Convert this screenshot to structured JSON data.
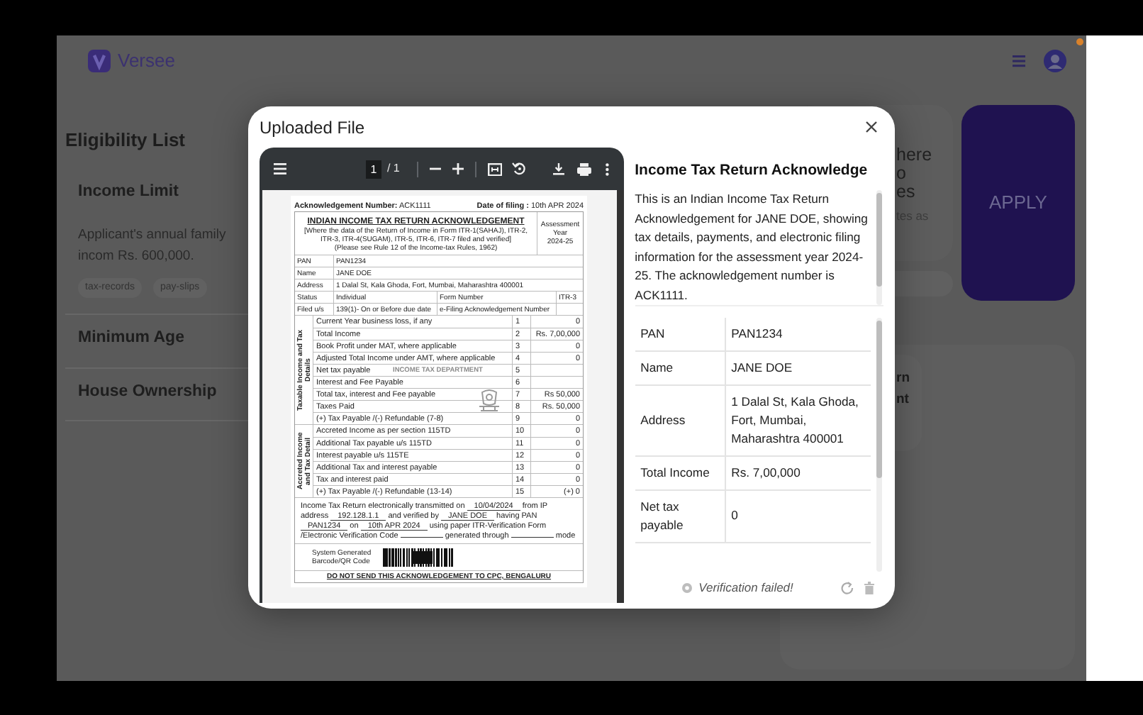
{
  "app": {
    "brand": "Versee"
  },
  "eligibility": {
    "title": "Eligibility List",
    "items": [
      {
        "title": "Income Limit",
        "description": "Applicant's annual family incom Rs. 600,000.",
        "tags": [
          "tax-records",
          "pay-slips"
        ]
      },
      {
        "title": "Minimum Age"
      },
      {
        "title": "House Ownership"
      }
    ]
  },
  "promo_card": {
    "lines": [
      "here",
      "o",
      "es"
    ],
    "note": "tes as"
  },
  "apply_button": "APPLY",
  "info_card": {
    "lines": [
      "rn",
      "nt"
    ]
  },
  "modal": {
    "title": "Uploaded File",
    "viewer": {
      "page": "1",
      "page_total": "/ 1",
      "document": {
        "ack_label": "Acknowledgement Number:",
        "ack_number": "ACK1111",
        "date_label": "Date of filing :",
        "date": "10th APR 2024",
        "title": "INDIAN INCOME TAX RETURN ACKNOWLEDGEMENT",
        "subtitle": "[Where the data of the Return of Income in Form ITR-1(SAHAJ), ITR-2, ITR-3, ITR-4(SUGAM), ITR-5, ITR-6, ITR-7 filed and verified]",
        "rule_note": "(Please see Rule 12 of the Income-tax Rules, 1962)",
        "ay_label": "Assessment Year",
        "ay": "2024-25",
        "info_rows": [
          {
            "cells": [
              "PAN",
              "PAN1234"
            ]
          },
          {
            "cells": [
              "Name",
              "JANE DOE"
            ]
          },
          {
            "cells": [
              "Address",
              "1 Dalal St, Kala Ghoda, Fort, Mumbai, Maharashtra 400001"
            ]
          },
          {
            "cells": [
              "Status",
              "Individual",
              "Form Number",
              "ITR-3"
            ]
          },
          {
            "cells": [
              "Filed u/s",
              "139(1)- On or Before due date",
              "e-Filing Acknowledgement Number"
            ]
          }
        ],
        "sections": [
          {
            "heading": "Taxable Income and Tax Details",
            "rows": [
              {
                "label": "Current Year business loss, if any",
                "no": "1",
                "value": "0"
              },
              {
                "label": "Total Income",
                "no": "2",
                "value": "Rs. 7,00,000"
              },
              {
                "label": "Book Profit under MAT, where applicable",
                "no": "3",
                "value": "0"
              },
              {
                "label": "Adjusted Total Income under AMT, where applicable",
                "no": "4",
                "value": "0"
              },
              {
                "label": "Net tax payable",
                "no": "5"
              },
              {
                "label": "Interest and Fee Payable",
                "no": "6"
              },
              {
                "label": "Total tax, interest and Fee payable",
                "no": "7",
                "value": "Rs 50,000"
              },
              {
                "label": "Taxes Paid",
                "no": "8",
                "value": "Rs. 50,000"
              },
              {
                "label": "(+) Tax Payable /(-) Refundable (7-8)",
                "no": "9",
                "value": "0"
              }
            ]
          },
          {
            "heading": "Accreted Income and Tax Detail",
            "rows": [
              {
                "label": "Accreted Income as per section 115TD",
                "no": "10",
                "value": "0"
              },
              {
                "label": "Additional Tax payable u/s 115TD",
                "no": "11",
                "value": "0"
              },
              {
                "label": "Interest payable u/s 115TE",
                "no": "12",
                "value": "0"
              },
              {
                "label": "Additional Tax and interest payable",
                "no": "13",
                "value": "0"
              },
              {
                "label": "Tax and interest paid",
                "no": "14",
                "value": "0"
              },
              {
                "label": "(+) Tax Payable /(-) Refundable (13-14)",
                "no": "15",
                "value": "(+) 0"
              }
            ]
          }
        ],
        "declaration": [
          {
            "kind": "text",
            "text": "Income Tax Return electronically transmitted on"
          },
          {
            "kind": "fill",
            "text": "10/04/2024"
          },
          {
            "kind": "text",
            "text": "from IP address"
          },
          {
            "kind": "fill",
            "text": "192.128.1.1"
          },
          {
            "kind": "text",
            "text": "and verified by"
          },
          {
            "kind": "fill",
            "text": "JANE DOE"
          },
          {
            "kind": "text",
            "text": "having PAN"
          },
          {
            "kind": "fill",
            "text": "PAN1234"
          },
          {
            "kind": "text",
            "text": "on"
          },
          {
            "kind": "fill",
            "text": "10th APR 2024"
          },
          {
            "kind": "text",
            "text": "using paper ITR-Verification Form /Electronic Verification Code"
          },
          {
            "kind": "gap"
          },
          {
            "kind": "text",
            "text": "generated through"
          },
          {
            "kind": "gap"
          },
          {
            "kind": "text",
            "text": "mode"
          }
        ],
        "barcode_label": "System Generated Barcode/QR Code",
        "notice": "DO NOT SEND THIS ACKNOWLEDGEMENT TO CPC, BENGALURU",
        "watermark": "INCOME TAX DEPARTMENT"
      }
    },
    "summary": {
      "title": "Income Tax Return Acknowledge",
      "description": "This is an Indian Income Tax Return Acknowledgement for JANE DOE, showing tax details, payments, and electronic filing information for the assessment year 2024-25. The acknowledgement number is ACK1111.",
      "rows": [
        {
          "label": "PAN",
          "value": "PAN1234"
        },
        {
          "label": "Name",
          "value": "JANE DOE"
        },
        {
          "label": "Address",
          "value": "1 Dalal St, Kala Ghoda, Fort, Mumbai, Maharashtra 400001"
        },
        {
          "label": "Total Income",
          "value": "Rs. 7,00,000"
        },
        {
          "label": "Net tax payable",
          "value": "0"
        }
      ],
      "status": {
        "text": "Verification failed!",
        "verified": false
      }
    }
  }
}
